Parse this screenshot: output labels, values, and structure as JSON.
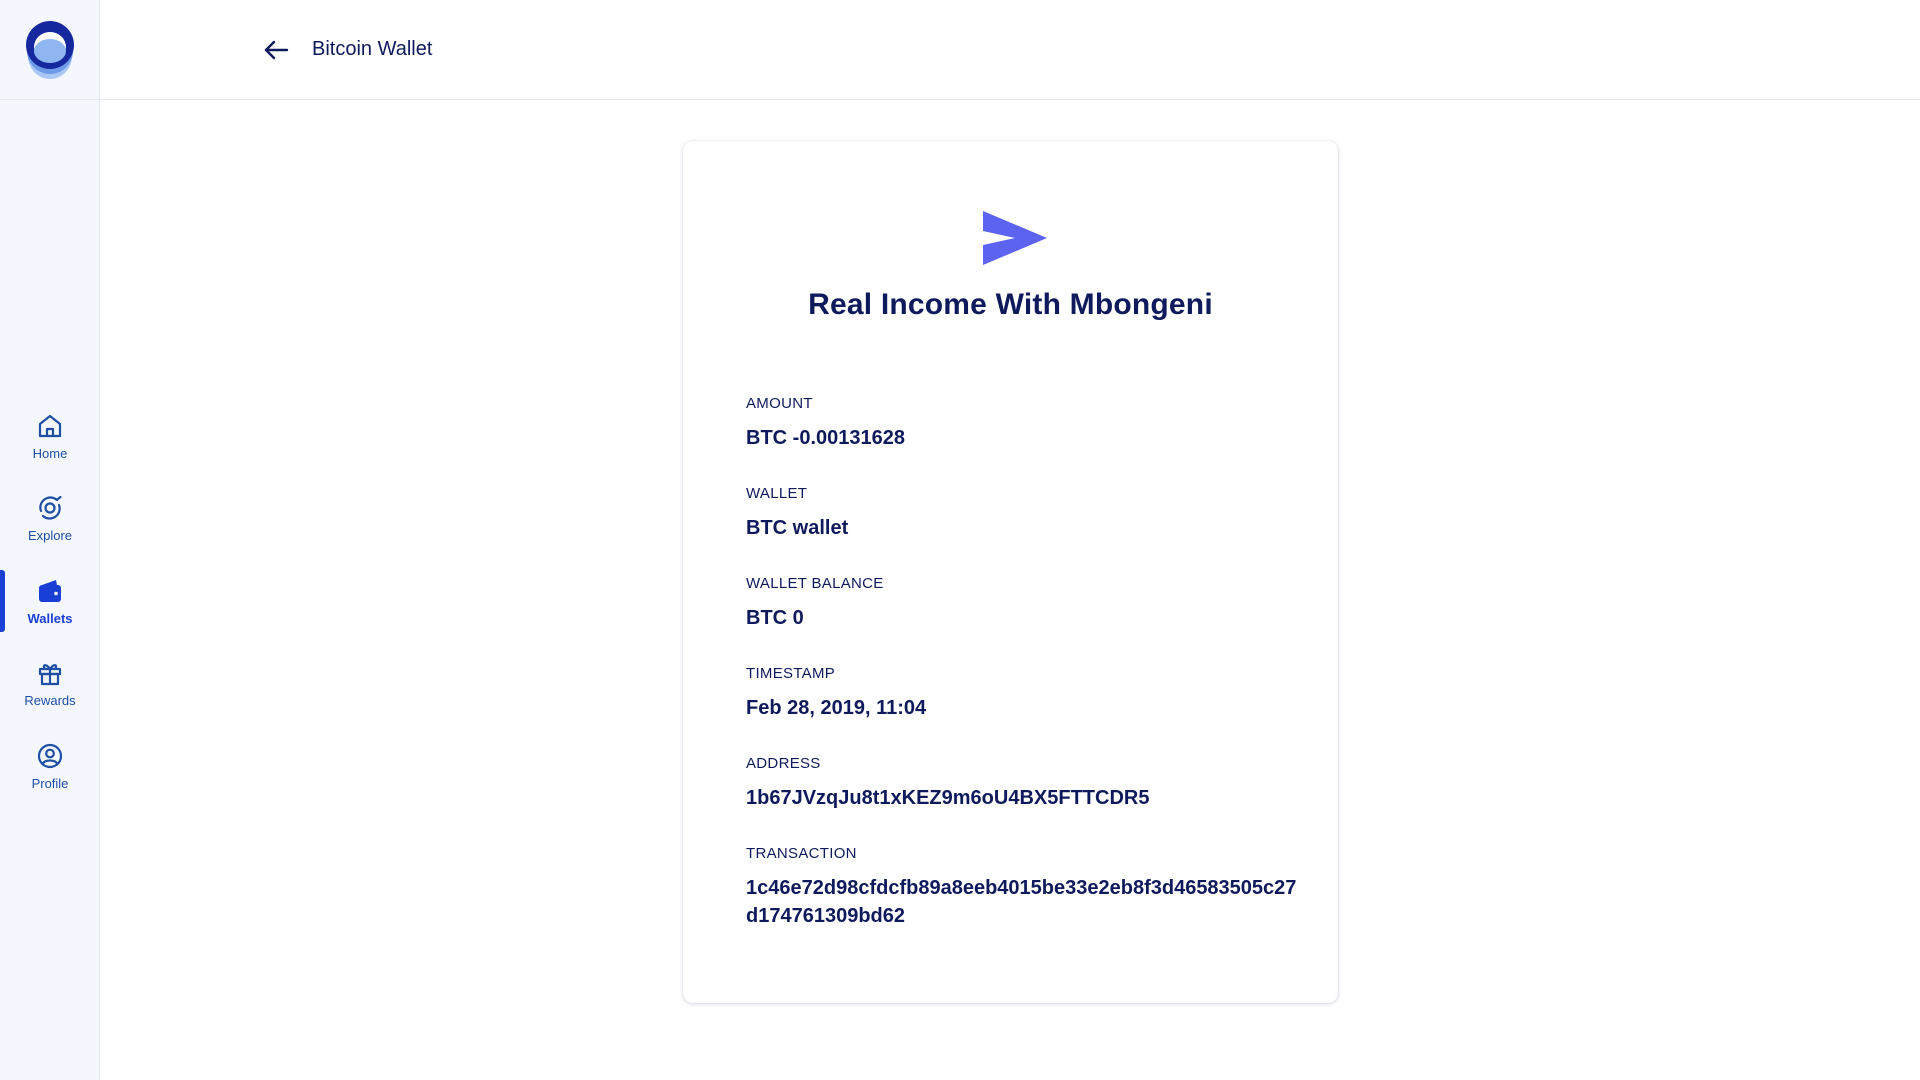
{
  "header": {
    "title": "Bitcoin Wallet"
  },
  "sidebar": {
    "items": [
      {
        "label": "Home",
        "icon": "home-icon",
        "active": false
      },
      {
        "label": "Explore",
        "icon": "explore-icon",
        "active": false
      },
      {
        "label": "Wallets",
        "icon": "wallet-icon",
        "active": true
      },
      {
        "label": "Rewards",
        "icon": "gift-icon",
        "active": false
      },
      {
        "label": "Profile",
        "icon": "profile-icon",
        "active": false
      }
    ]
  },
  "transaction": {
    "title": "Real Income With Mbongeni",
    "icon": "send-icon",
    "fields": [
      {
        "label": "AMOUNT",
        "value": "BTC -0.00131628"
      },
      {
        "label": "WALLET",
        "value": "BTC wallet"
      },
      {
        "label": "WALLET BALANCE",
        "value": "BTC 0"
      },
      {
        "label": "TIMESTAMP",
        "value": "Feb 28, 2019, 11:04"
      },
      {
        "label": "ADDRESS",
        "value": "1b67JVzqJu8t1xKEZ9m6oU4BX5FTTCDR5"
      },
      {
        "label": "TRANSACTION",
        "value": "1c46e72d98cfdcfb89a8eeb4015be33e2eb8f3d46583505c27d174761309bd62"
      }
    ]
  },
  "colors": {
    "primary": "#0f1a5c",
    "accent": "#1a3fd6",
    "send_icon": "#5b63f0",
    "sidebar_bg": "#f4f7fd"
  }
}
